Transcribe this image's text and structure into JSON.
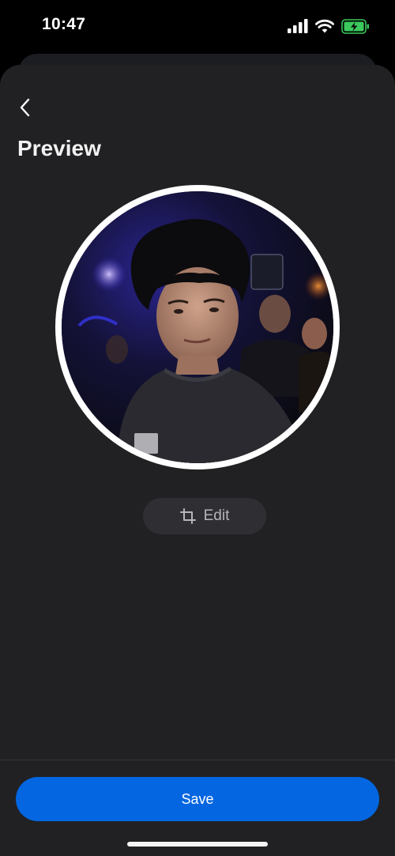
{
  "status_bar": {
    "time": "10:47",
    "icons": [
      "signal-icon",
      "wifi-icon",
      "battery-charging-icon"
    ],
    "battery_color": "#3ac95c"
  },
  "header": {
    "back_icon": "chevron-left-icon",
    "title": "Preview"
  },
  "preview": {
    "image": "profile-photo"
  },
  "edit": {
    "icon": "crop-icon",
    "label": "Edit"
  },
  "footer": {
    "save_label": "Save"
  },
  "colors": {
    "background": "#000000",
    "sheet": "#212124",
    "edit_pill": "#2f2f33",
    "primary": "#0466e0",
    "avatar_ring": "#ffffff"
  }
}
